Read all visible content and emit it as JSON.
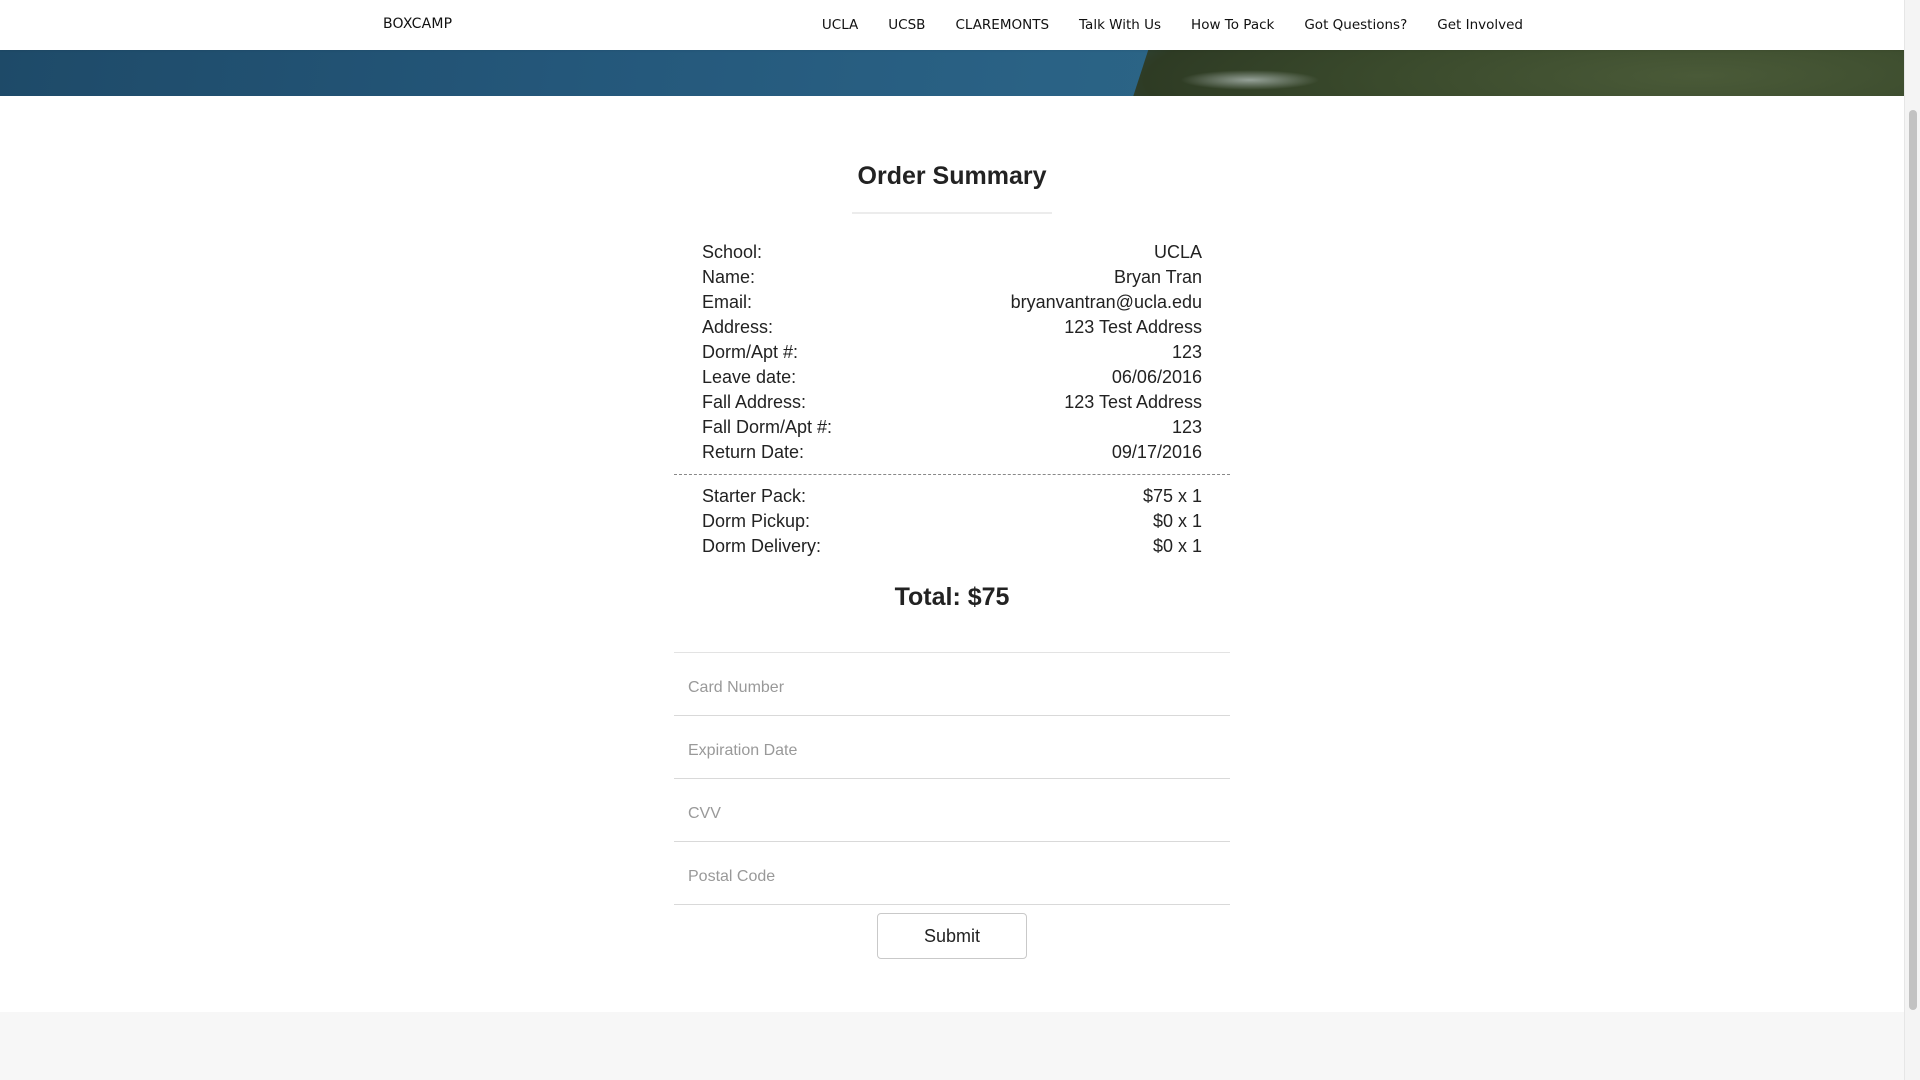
{
  "brand": "BOXCAMP",
  "nav": [
    "UCLA",
    "UCSB",
    "CLAREMONTS",
    "Talk With Us",
    "How To Pack",
    "Got Questions?",
    "Get Involved"
  ],
  "summary": {
    "title": "Order Summary",
    "details": [
      {
        "label": "School:",
        "value": "UCLA"
      },
      {
        "label": "Name:",
        "value": "Bryan Tran"
      },
      {
        "label": "Email:",
        "value": "bryanvantran@ucla.edu"
      },
      {
        "label": "Address:",
        "value": "123 Test Address"
      },
      {
        "label": "Dorm/Apt #:",
        "value": "123"
      },
      {
        "label": "Leave date:",
        "value": "06/06/2016"
      },
      {
        "label": "Fall Address:",
        "value": "123 Test Address"
      },
      {
        "label": "Fall Dorm/Apt #:",
        "value": "123"
      },
      {
        "label": "Return Date:",
        "value": "09/17/2016"
      }
    ],
    "items": [
      {
        "label": "Starter Pack:",
        "value": "$75 x 1"
      },
      {
        "label": "Dorm Pickup:",
        "value": "$0 x 1"
      },
      {
        "label": "Dorm Delivery:",
        "value": "$0 x 1"
      }
    ],
    "total": "Total: $75"
  },
  "form": {
    "card_number": {
      "placeholder": "Card Number",
      "value": ""
    },
    "expiration": {
      "placeholder": "Expiration Date",
      "value": ""
    },
    "cvv": {
      "placeholder": "CVV",
      "value": ""
    },
    "postal": {
      "placeholder": "Postal Code",
      "value": ""
    },
    "submit_label": "Submit"
  }
}
